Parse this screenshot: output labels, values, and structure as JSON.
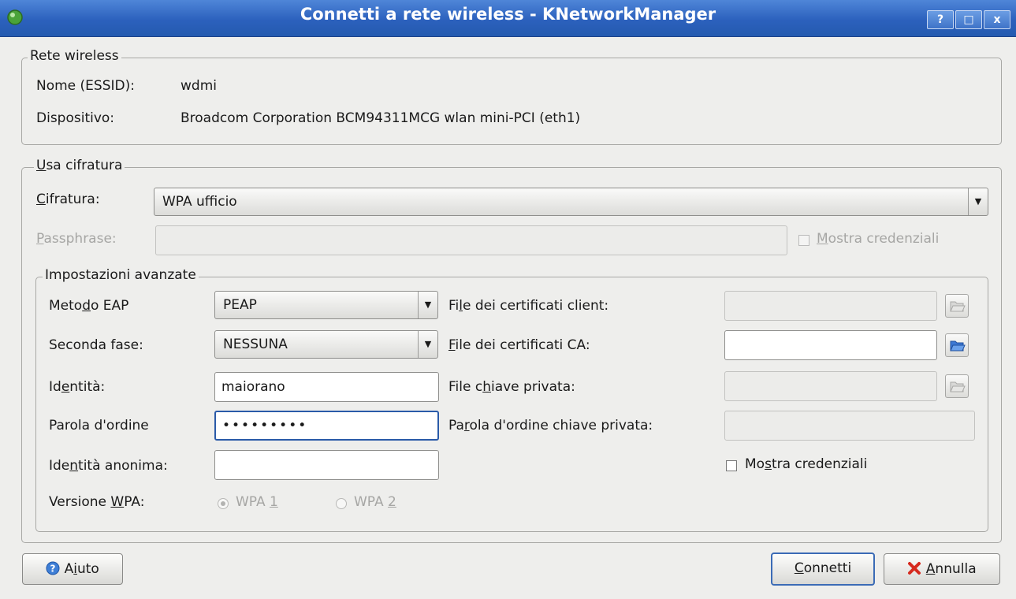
{
  "window": {
    "title": "Connetti a rete wireless - KNetworkManager",
    "buttons": {
      "help": "?",
      "maximize": "□",
      "close": "x"
    }
  },
  "wireless_group": {
    "legend": "Rete wireless",
    "essid_label": "Nome (ESSID):",
    "essid_value": "wdmi",
    "device_label": "Dispositivo:",
    "device_value": "Broadcom Corporation BCM94311MCG wlan mini-PCI (eth1)"
  },
  "encryption_group": {
    "legend_first": "U",
    "legend_rest": "sa cifratura",
    "cipher_label_first": "C",
    "cipher_label_rest": "ifratura:",
    "cipher_value": "WPA ufficio",
    "passphrase_label_first": "P",
    "passphrase_label_rest": "assphrase:",
    "passphrase_value": "",
    "show_credentials_first": "M",
    "show_credentials_rest": "ostra credenziali",
    "show_credentials_checked": false
  },
  "advanced_group": {
    "legend": "Impostazioni avanzate",
    "eap_label": {
      "pre": "Meto",
      "acc": "d",
      "post": "o EAP"
    },
    "eap_value": "PEAP",
    "phase2_label": "Seconda fase:",
    "phase2_value": "NESSUNA",
    "identity_label": {
      "pre": "Id",
      "acc": "e",
      "post": "ntità:"
    },
    "identity_value": "maiorano",
    "password_label": "Parola d'ordine",
    "password_value": "•••••••••",
    "anon_identity_label": {
      "pre": "Ide",
      "acc": "n",
      "post": "tità anonima:"
    },
    "anon_identity_value": "",
    "wpa_version_label": {
      "pre": "Versione ",
      "acc": "W",
      "post": "PA:"
    },
    "wpa1": {
      "pre": "WPA ",
      "acc": "1",
      "checked": true
    },
    "wpa2": {
      "pre": "WPA ",
      "acc": "2",
      "checked": false
    },
    "client_cert_label": {
      "pre": "Fi",
      "acc": "l",
      "post": "e dei certificati client:"
    },
    "client_cert_value": "",
    "ca_cert_label": {
      "pre": "",
      "acc": "F",
      "post": "ile dei certificati CA:"
    },
    "ca_cert_value": "",
    "private_key_label": {
      "pre": "File c",
      "acc": "h",
      "post": "iave privata:"
    },
    "private_key_value": "",
    "private_key_pw_label": {
      "pre": "Pa",
      "acc": "r",
      "post": "ola d'ordine chiave privata:"
    },
    "private_key_pw_value": "",
    "show_credentials": {
      "pre": "Mo",
      "acc": "s",
      "post": "tra credenziali",
      "checked": false
    }
  },
  "footer": {
    "help": {
      "pre": "A",
      "acc": "i",
      "post": "uto"
    },
    "connect": {
      "pre": "",
      "acc": "C",
      "post": "onnetti"
    },
    "cancel": {
      "pre": "",
      "acc": "A",
      "post": "nnulla"
    }
  },
  "colors": {
    "titlebar": "#2c61bd",
    "background": "#eeeeec",
    "focus": "#2a5aa8"
  }
}
